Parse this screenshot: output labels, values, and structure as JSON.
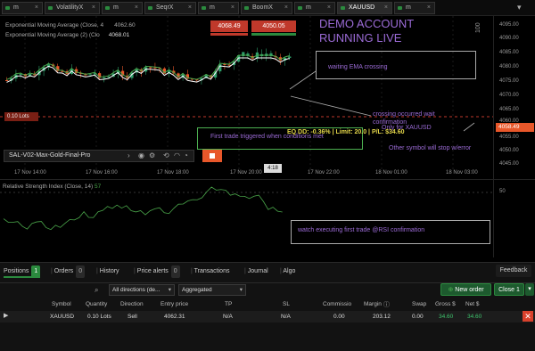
{
  "tabs": [
    {
      "label": "m"
    },
    {
      "label": "VolatilityX"
    },
    {
      "label": "m"
    },
    {
      "label": "SeqrX"
    },
    {
      "label": "m"
    },
    {
      "label": "BoomX"
    },
    {
      "label": "m"
    },
    {
      "label": "XAUUSD"
    },
    {
      "label": "m"
    }
  ],
  "chart": {
    "legend1_label": "Exponential Moving Average (Close, 4",
    "legend1_value": "4062.60",
    "legend2_label": "Exponential Moving Average (2) (Clo",
    "legend2_value": "4068.01",
    "bid": "4068.49",
    "ask": "4050.05",
    "account_title": "DEMO ACCOUNT",
    "account_sub": "RUNNING LIVE",
    "position_label": "0.10 Lots",
    "robot_name": "SAL-V02-Max-Gold-Final-Pro",
    "eq_text": "EQ DD: -0.36% | Limit: 20.0 | P/L: $34.60",
    "price_tag": "4058.49",
    "crosshair_x": "4:18",
    "annotations": {
      "waiting": "waiting EMA crossing",
      "crossing": "crossing occurred wait",
      "confirmation": "confirmation",
      "only_for": "Only for XAUUSD",
      "other": "Other symbol will stop w/error",
      "first_trade": "First trade triggered when conditions met",
      "watch": "watch executing first trade @RSI confirmation"
    },
    "yticks": [
      "4095.00",
      "4090.00",
      "4085.00",
      "4080.00",
      "4075.00",
      "4070.00",
      "4065.00",
      "4060.00",
      "4055.00",
      "4050.00",
      "4045.00"
    ],
    "xticks": [
      "17 Nov 14:00",
      "17 Nov 16:00",
      "17 Nov 18:00",
      "17 Nov 20:00",
      "17 Nov 22:00",
      "18 Nov 01:00",
      "18 Nov 03:00"
    ],
    "rsi_label": "Relative Strength Index (Close, 14)",
    "rsi_value": "57",
    "rsi_tick": "50",
    "scale_label": "100"
  },
  "bottom": {
    "tabs": [
      {
        "label": "Positions",
        "count": "1"
      },
      {
        "label": "Orders",
        "count": "0"
      },
      {
        "label": "History",
        "count": ""
      },
      {
        "label": "Price alerts",
        "count": "0"
      },
      {
        "label": "Transactions",
        "count": ""
      },
      {
        "label": "Journal",
        "count": ""
      },
      {
        "label": "Algo",
        "count": ""
      }
    ],
    "feedback": "Feedback",
    "directions": "All directions (de...",
    "aggregated": "Aggregated",
    "new_order": "New order",
    "close": "Close",
    "close_count": "1",
    "columns": [
      "Symbol",
      "Quantity",
      "Direction",
      "Entry price",
      "TP",
      "SL",
      "Commissio",
      "Margin",
      "Swap",
      "Gross $",
      "Net $"
    ],
    "row": [
      "XAUUSD",
      "0.10 Lots",
      "Sell",
      "4062.31",
      "N/A",
      "N/A",
      "0.00",
      "203.12",
      "0.00",
      "34.60",
      "34.60"
    ]
  },
  "colors": {
    "bull": "#2e9e6a",
    "bear": "#e8572a",
    "ema1": "#ffffff",
    "ema2": "#4aa64a",
    "accent": "#9b6bd6",
    "eq": "#e6d84a"
  }
}
